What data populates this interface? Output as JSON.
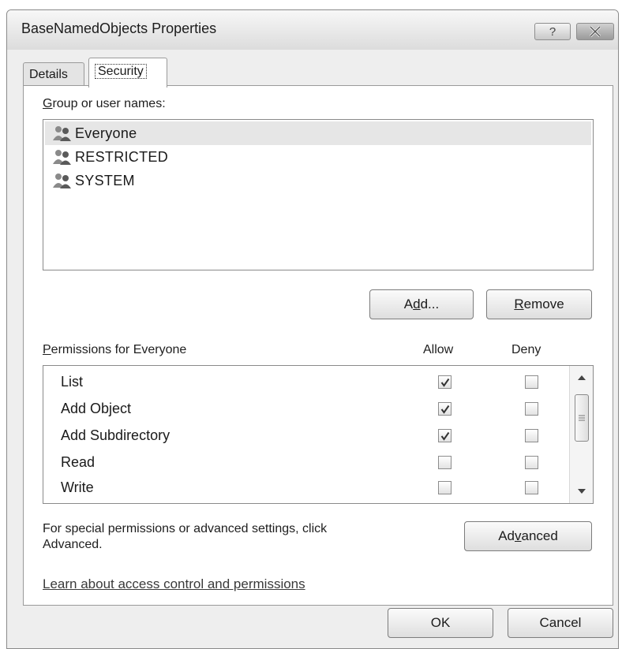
{
  "window": {
    "title": "BaseNamedObjects Properties",
    "help_label": "?"
  },
  "tabs": [
    {
      "label": "Details"
    },
    {
      "label": "Security",
      "selected": true
    }
  ],
  "groups": {
    "label_prefix": "G",
    "label_rest": "roup or user names:",
    "items": [
      {
        "name": "Everyone",
        "selected": true
      },
      {
        "name": "RESTRICTED"
      },
      {
        "name": "SYSTEM"
      }
    ],
    "add_before": "A",
    "add_accel": "d",
    "add_after": "d...",
    "remove_accel": "R",
    "remove_after": "emove"
  },
  "permissions": {
    "label_prefix": "P",
    "label_rest": "ermissions for Everyone",
    "allow_header": "Allow",
    "deny_header": "Deny",
    "rows": [
      {
        "name": "List",
        "allow": true,
        "deny": false
      },
      {
        "name": "Add Object",
        "allow": true,
        "deny": false
      },
      {
        "name": "Add Subdirectory",
        "allow": true,
        "deny": false
      },
      {
        "name": "Read",
        "allow": false,
        "deny": false
      },
      {
        "name": "Write",
        "allow": false,
        "deny": false
      }
    ]
  },
  "advanced": {
    "text_line1": "For special permissions or advanced settings, click",
    "text_line2": "Advanced.",
    "button_before": "Ad",
    "button_accel": "v",
    "button_after": "anced"
  },
  "link_text": "Learn about access control and permissions",
  "footer": {
    "ok_label": "OK",
    "cancel_label": "Cancel"
  },
  "colors": {
    "window_bg": "#eeeeee",
    "selection": "#e6e6e6",
    "border": "#8a8a8a"
  },
  "icons": {
    "help": "question-mark",
    "close": "x-mark",
    "user_group": "two-users",
    "check": "checkmark",
    "scroll_up": "triangle-up",
    "scroll_down": "triangle-down",
    "scroll_grip": "three-lines"
  }
}
